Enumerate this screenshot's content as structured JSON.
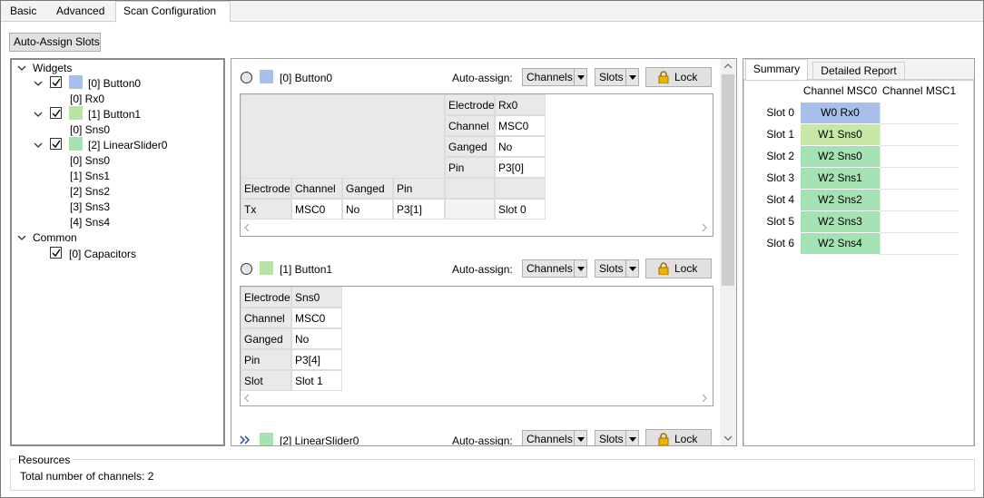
{
  "tabs": [
    "Basic",
    "Advanced",
    "Scan Configuration"
  ],
  "toolbar": {
    "auto_assign_slots": "Auto-Assign Slots"
  },
  "tree": {
    "widgets_label": "Widgets",
    "widgets": [
      {
        "label": "[0] Button0",
        "color": "#a9bfeb",
        "children": [
          "[0] Rx0"
        ]
      },
      {
        "label": "[1] Button1",
        "color": "#b9e3a6",
        "children": [
          "[0] Sns0"
        ]
      },
      {
        "label": "[2] LinearSlider0",
        "color": "#a5e3b5",
        "children": [
          "[0] Sns0",
          "[1] Sns1",
          "[2] Sns2",
          "[3] Sns3",
          "[4] Sns4"
        ]
      }
    ],
    "common_label": "Common",
    "common": [
      {
        "label": "[0] Capacitors"
      }
    ]
  },
  "widget_blocks": [
    {
      "name": "[0] Button0",
      "color": "#a9bfeb",
      "auto_assign_label": "Auto-assign:",
      "channels": "Channels",
      "slots": "Slots",
      "lock": "Lock",
      "rx_table": {
        "rows": [
          [
            "Electrode",
            "Rx0"
          ],
          [
            "Channel",
            "MSC0"
          ],
          [
            "Ganged",
            "No"
          ],
          [
            "Pin",
            "P3[0]"
          ]
        ]
      },
      "tx_header": [
        "Electrode",
        "Channel",
        "Ganged",
        "Pin"
      ],
      "tx_row": [
        "Tx",
        "MSC0",
        "No",
        "P3[1]"
      ],
      "slot": "Slot 0"
    },
    {
      "name": "[1] Button1",
      "color": "#b9e3a6",
      "auto_assign_label": "Auto-assign:",
      "channels": "Channels",
      "slots": "Slots",
      "lock": "Lock",
      "rows": [
        [
          "Electrode",
          "Sns0"
        ],
        [
          "Channel",
          "MSC0"
        ],
        [
          "Ganged",
          "No"
        ],
        [
          "Pin",
          "P3[4]"
        ],
        [
          "Slot",
          "Slot 1"
        ]
      ]
    },
    {
      "name": "[2] LinearSlider0",
      "color": "#a5e3b5",
      "auto_assign_label": "Auto-assign:",
      "channels": "Channels",
      "slots": "Slots",
      "lock": "Lock"
    }
  ],
  "summary": {
    "tabs": [
      "Summary",
      "Detailed Report"
    ],
    "columns": [
      "Channel MSC0",
      "Channel MSC1"
    ],
    "rows": [
      {
        "slot": "Slot 0",
        "msc0": "W0 Rx0",
        "color": "#a9bfeb"
      },
      {
        "slot": "Slot 1",
        "msc0": "W1 Sns0",
        "color": "#c7e8a5"
      },
      {
        "slot": "Slot 2",
        "msc0": "W2 Sns0",
        "color": "#a5e3b5"
      },
      {
        "slot": "Slot 3",
        "msc0": "W2 Sns1",
        "color": "#a5e3b5"
      },
      {
        "slot": "Slot 4",
        "msc0": "W2 Sns2",
        "color": "#a5e3b5"
      },
      {
        "slot": "Slot 5",
        "msc0": "W2 Sns3",
        "color": "#a5e3b5"
      },
      {
        "slot": "Slot 6",
        "msc0": "W2 Sns4",
        "color": "#a5e3b5"
      }
    ]
  },
  "resources": {
    "title": "Resources",
    "text": "Total number of channels: 2"
  }
}
